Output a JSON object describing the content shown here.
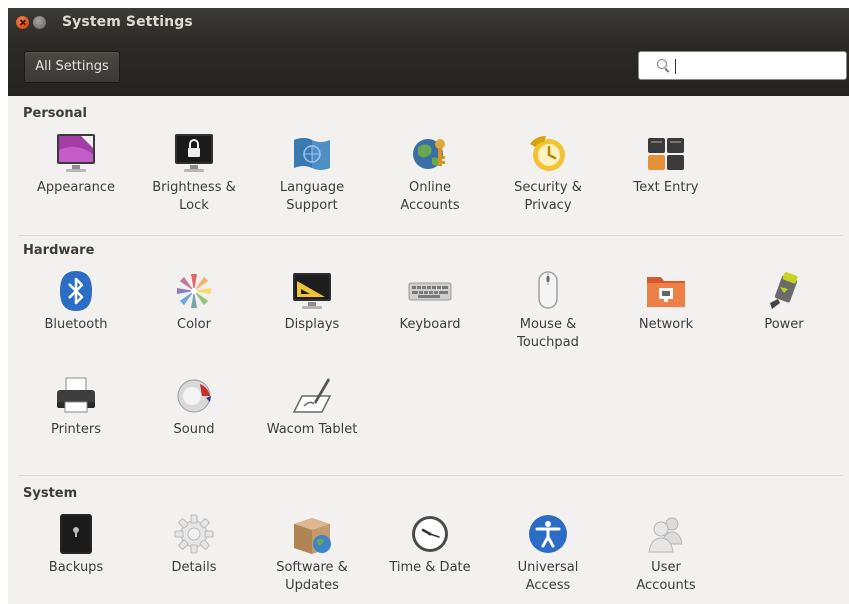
{
  "window": {
    "title": "System Settings"
  },
  "toolbar": {
    "all_settings_label": "All Settings",
    "search_value": ""
  },
  "sections": {
    "personal": {
      "header": "Personal",
      "items": [
        {
          "label_1": "Appearance",
          "label_2": "",
          "icon": "appearance-icon"
        },
        {
          "label_1": "Brightness &",
          "label_2": "Lock",
          "icon": "brightness-lock-icon"
        },
        {
          "label_1": "Language",
          "label_2": "Support",
          "icon": "language-support-icon"
        },
        {
          "label_1": "Online",
          "label_2": "Accounts",
          "icon": "online-accounts-icon"
        },
        {
          "label_1": "Security &",
          "label_2": "Privacy",
          "icon": "security-privacy-icon"
        },
        {
          "label_1": "Text Entry",
          "label_2": "",
          "icon": "text-entry-icon"
        }
      ]
    },
    "hardware": {
      "header": "Hardware",
      "items": [
        {
          "label_1": "Bluetooth",
          "label_2": "",
          "icon": "bluetooth-icon"
        },
        {
          "label_1": "Color",
          "label_2": "",
          "icon": "color-icon"
        },
        {
          "label_1": "Displays",
          "label_2": "",
          "icon": "displays-icon"
        },
        {
          "label_1": "Keyboard",
          "label_2": "",
          "icon": "keyboard-icon"
        },
        {
          "label_1": "Mouse &",
          "label_2": "Touchpad",
          "icon": "mouse-touchpad-icon"
        },
        {
          "label_1": "Network",
          "label_2": "",
          "icon": "network-icon"
        },
        {
          "label_1": "Power",
          "label_2": "",
          "icon": "power-icon"
        },
        {
          "label_1": "Printers",
          "label_2": "",
          "icon": "printers-icon"
        },
        {
          "label_1": "Sound",
          "label_2": "",
          "icon": "sound-icon"
        },
        {
          "label_1": "Wacom Tablet",
          "label_2": "",
          "icon": "wacom-tablet-icon"
        }
      ]
    },
    "system": {
      "header": "System",
      "items": [
        {
          "label_1": "Backups",
          "label_2": "",
          "icon": "backups-icon"
        },
        {
          "label_1": "Details",
          "label_2": "",
          "icon": "details-icon"
        },
        {
          "label_1": "Software &",
          "label_2": "Updates",
          "icon": "software-updates-icon"
        },
        {
          "label_1": "Time & Date",
          "label_2": "",
          "icon": "time-date-icon"
        },
        {
          "label_1": "Universal",
          "label_2": "Access",
          "icon": "universal-access-icon"
        },
        {
          "label_1": "User",
          "label_2": "Accounts",
          "icon": "user-accounts-icon"
        }
      ]
    }
  }
}
